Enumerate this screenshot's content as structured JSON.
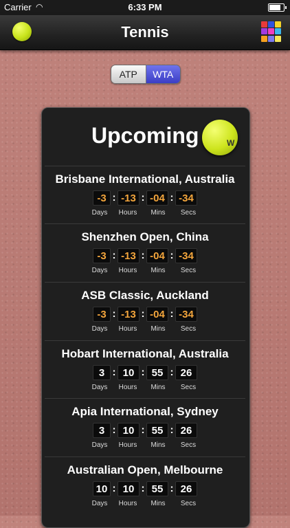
{
  "status_bar": {
    "carrier": "Carrier",
    "time": "6:33 PM",
    "battery_level": 0.9
  },
  "nav": {
    "title": "Tennis",
    "left_icon": "tennis-ball-icon",
    "right_icon": "color-grid-icon",
    "grid_colors": [
      "#e83a3a",
      "#2f52e0",
      "#f5d42a",
      "#a23be0",
      "#f03fc0",
      "#3ab6ee",
      "#f6a01e",
      "#7a7af0",
      "#f5e85a"
    ]
  },
  "segment": {
    "options": [
      "ATP",
      "WTA"
    ],
    "selected": "WTA"
  },
  "card": {
    "heading": "Upcoming",
    "ball_logo": "W",
    "labels": {
      "days": "Days",
      "hours": "Hours",
      "mins": "Mins",
      "secs": "Secs"
    },
    "events": [
      {
        "name": "Brisbane International, Australia",
        "days": "-3",
        "hours": "-13",
        "mins": "-04",
        "secs": "-34",
        "negative": true
      },
      {
        "name": "Shenzhen Open, China",
        "days": "-3",
        "hours": "-13",
        "mins": "-04",
        "secs": "-34",
        "negative": true
      },
      {
        "name": "ASB Classic, Auckland",
        "days": "-3",
        "hours": "-13",
        "mins": "-04",
        "secs": "-34",
        "negative": true
      },
      {
        "name": "Hobart International, Australia",
        "days": "3",
        "hours": "10",
        "mins": "55",
        "secs": "26",
        "negative": false
      },
      {
        "name": "Apia International, Sydney",
        "days": "3",
        "hours": "10",
        "mins": "55",
        "secs": "26",
        "negative": false
      },
      {
        "name": "Australian Open, Melbourne",
        "days": "10",
        "hours": "10",
        "mins": "55",
        "secs": "26",
        "negative": false
      }
    ]
  }
}
